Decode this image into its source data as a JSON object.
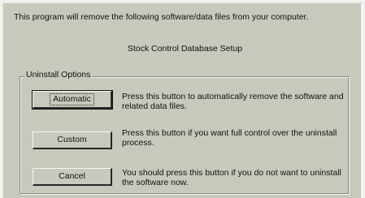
{
  "dialog": {
    "intro_text": "This program will remove the following software/data files from your computer.",
    "product_name": "Stock Control Database Setup",
    "group_label": "Uninstall Options"
  },
  "options": [
    {
      "button_label": "Automatic",
      "description": "Press this button to automatically remove the software and related data files."
    },
    {
      "button_label": "Custom",
      "description": "Press this button if you want full control over the uninstall process."
    },
    {
      "button_label": "Cancel",
      "description": "You should press this button if you do not want to uninstall the software now."
    }
  ]
}
